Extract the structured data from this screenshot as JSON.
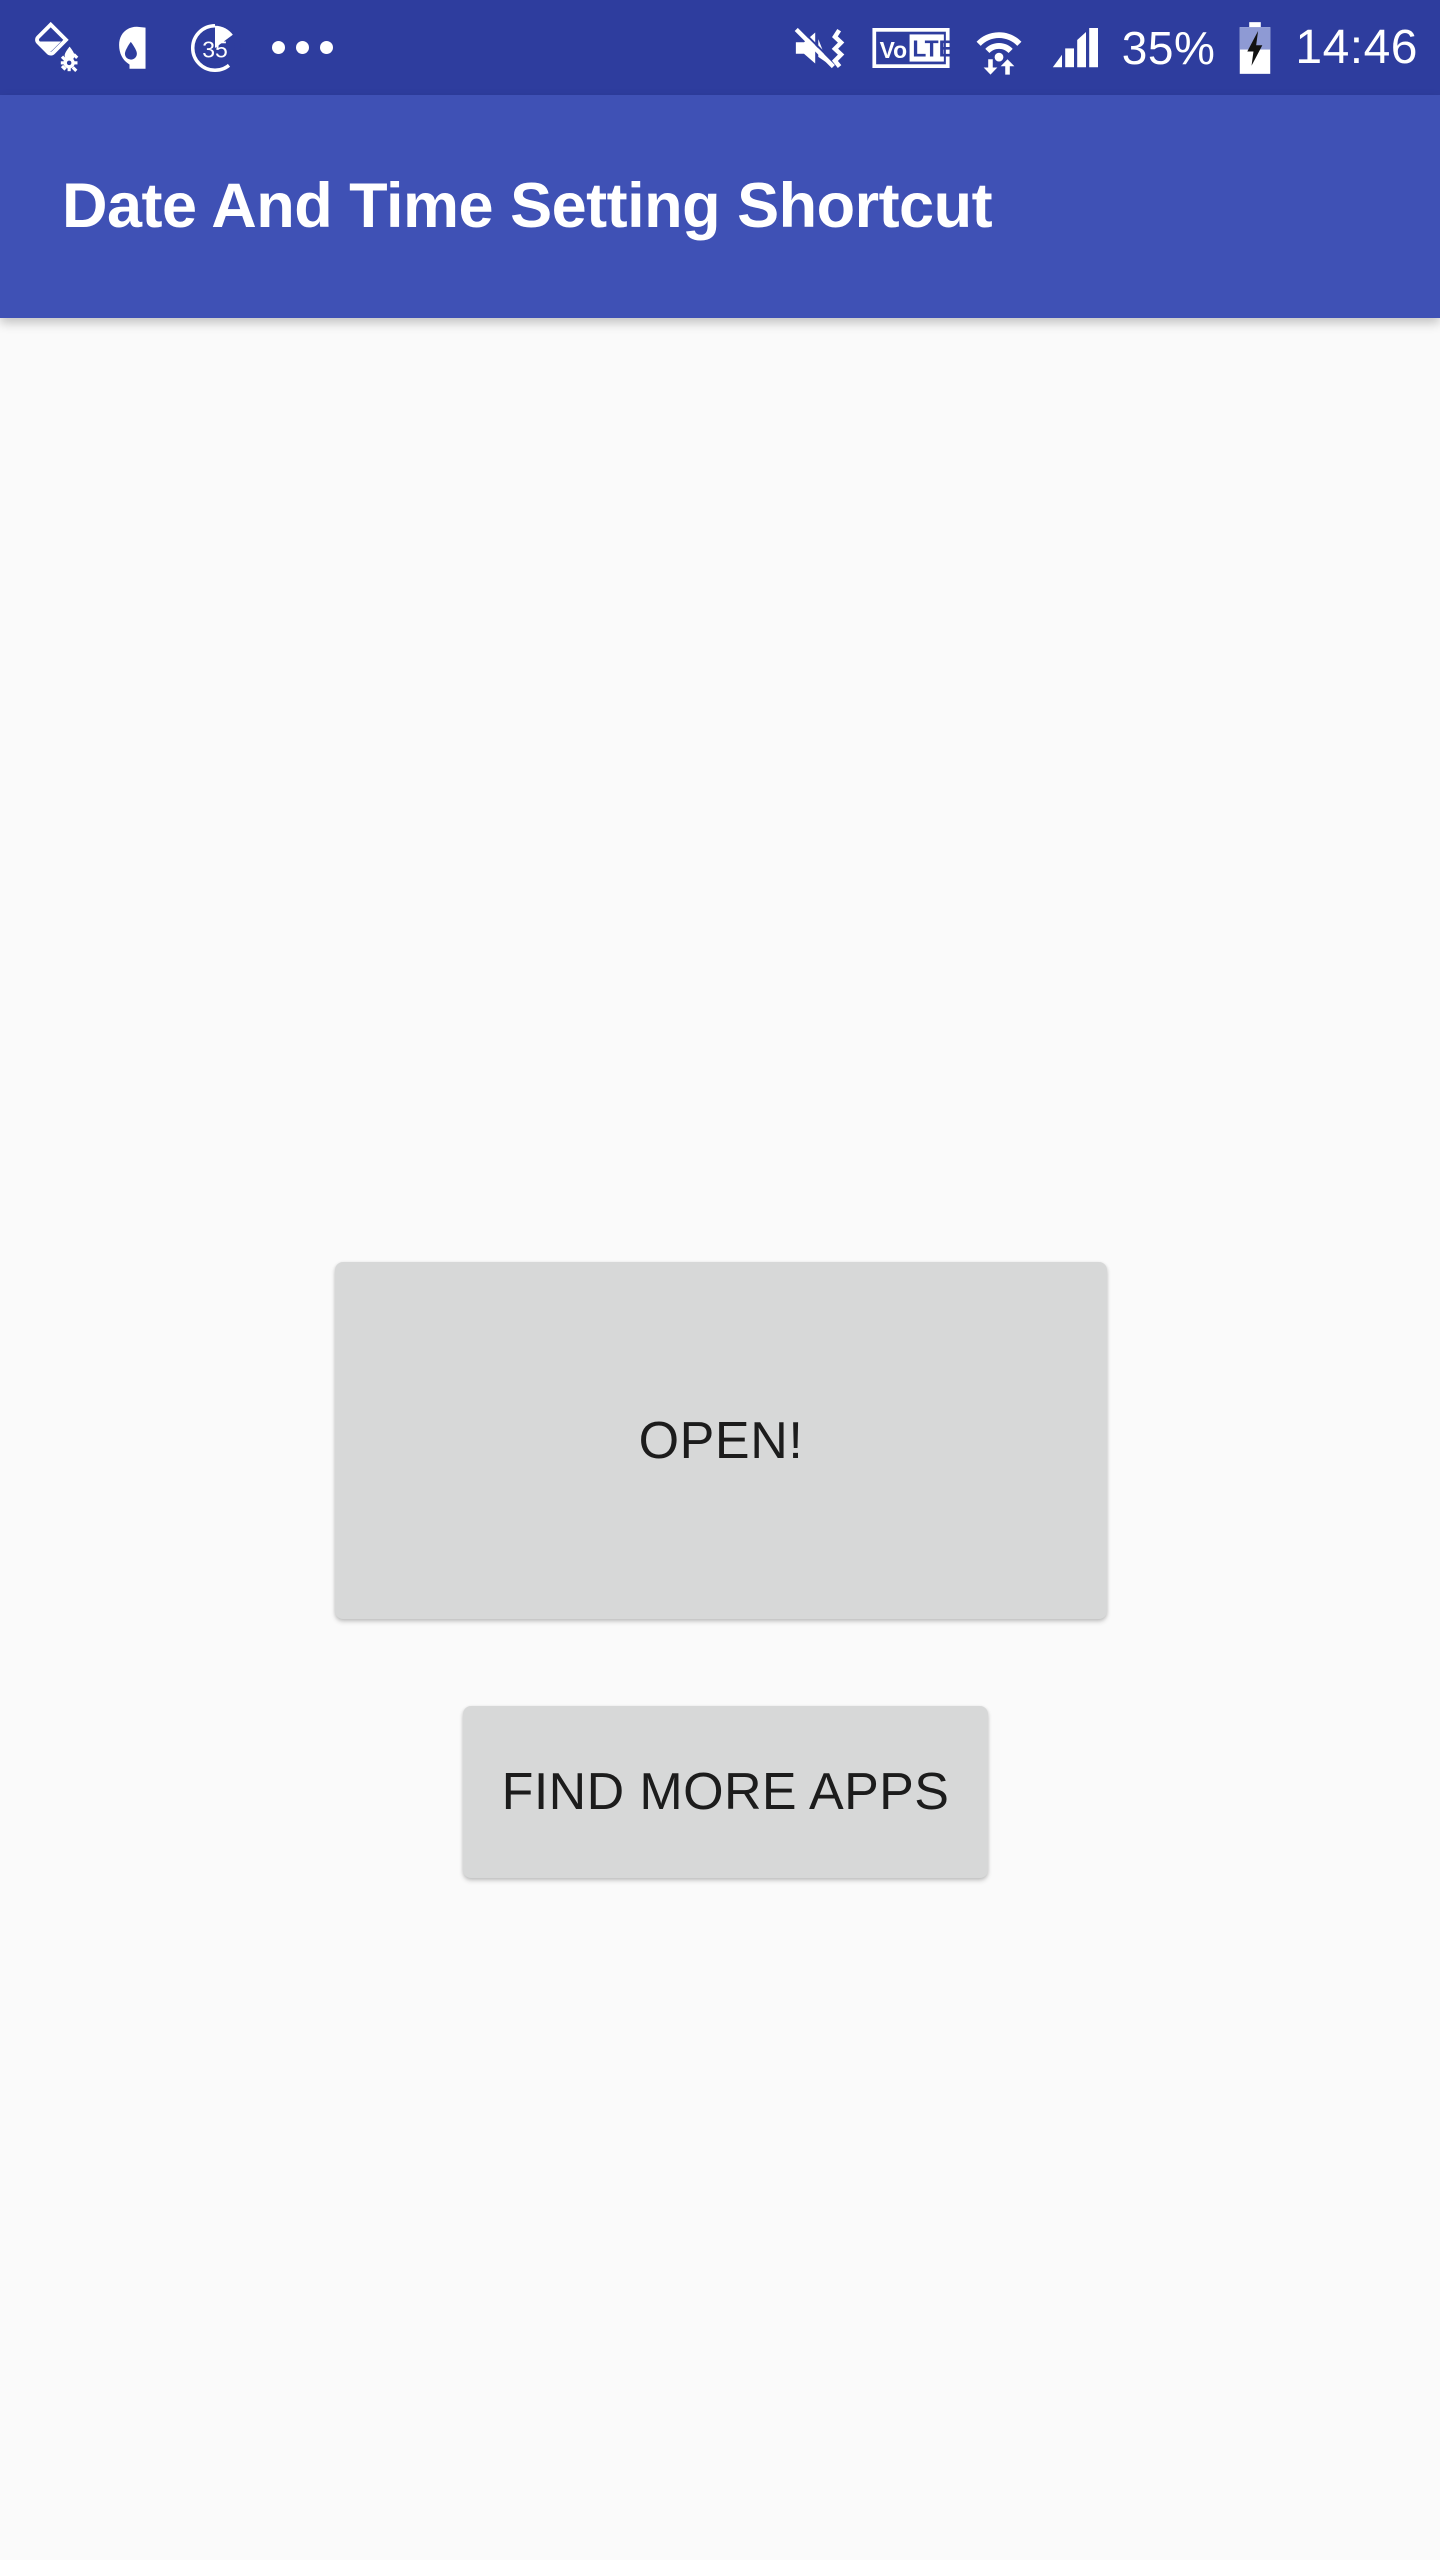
{
  "theme": {
    "status_bar_color": "#2e3d9e",
    "app_bar_color": "#3f51b5",
    "background_color": "#fafafa",
    "button_color": "#d7d8d8",
    "button_text_color": "#1c1c1c",
    "app_bar_text_color": "#ffffff"
  },
  "status_bar": {
    "left_icons": [
      {
        "name": "paint-bucket-gear-icon",
        "label": ""
      },
      {
        "name": "app-logo-a-icon",
        "label": ""
      },
      {
        "name": "circular-progress-35-icon",
        "label": "35"
      },
      {
        "name": "more-notifications-icon",
        "label": "..."
      }
    ],
    "right_icons": [
      {
        "name": "mute-vibrate-icon",
        "label": ""
      },
      {
        "name": "volte-icon",
        "label": "VoLTE"
      },
      {
        "name": "wifi-data-transfer-icon",
        "label": ""
      },
      {
        "name": "cellular-signal-icon",
        "label": ""
      },
      {
        "name": "battery-charging-icon",
        "label": ""
      }
    ],
    "battery_percent": "35%",
    "clock": "14:46"
  },
  "app_bar": {
    "title": "Date And Time Setting Shortcut"
  },
  "main": {
    "open_button_label": "OPEN!",
    "find_more_apps_button_label": "FIND MORE APPS"
  }
}
